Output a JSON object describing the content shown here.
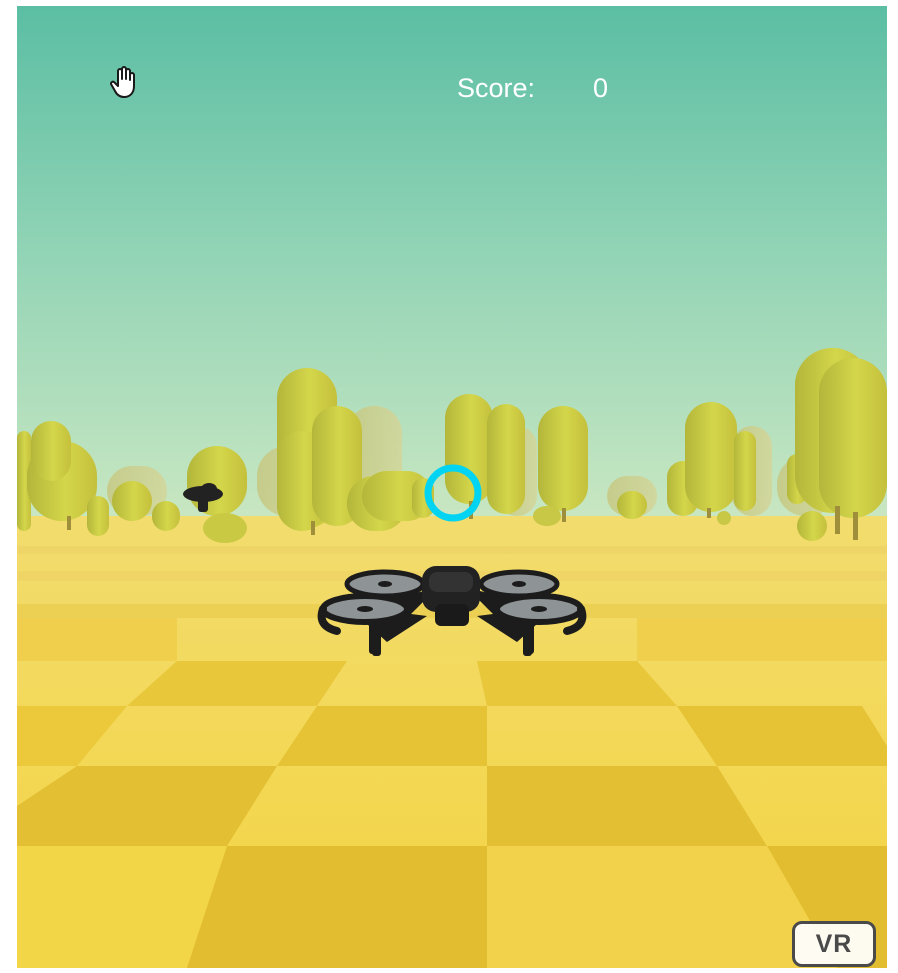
{
  "hud": {
    "score_label": "Score:",
    "score_value": "0"
  },
  "controls": {
    "hand_icon": "hand-pointer-icon",
    "vr_label": "VR"
  },
  "scene": {
    "sky_top_color": "#5bbea3",
    "sky_bottom_color": "#c7e6c0",
    "ground_light_color": "#f7dc4c",
    "ground_dark_color": "#e6c43a",
    "tree_color": "#cbcf3c",
    "ring_color": "#00d4f2",
    "drone_color": "#1c1c1c",
    "propeller_color": "#8e9395"
  }
}
